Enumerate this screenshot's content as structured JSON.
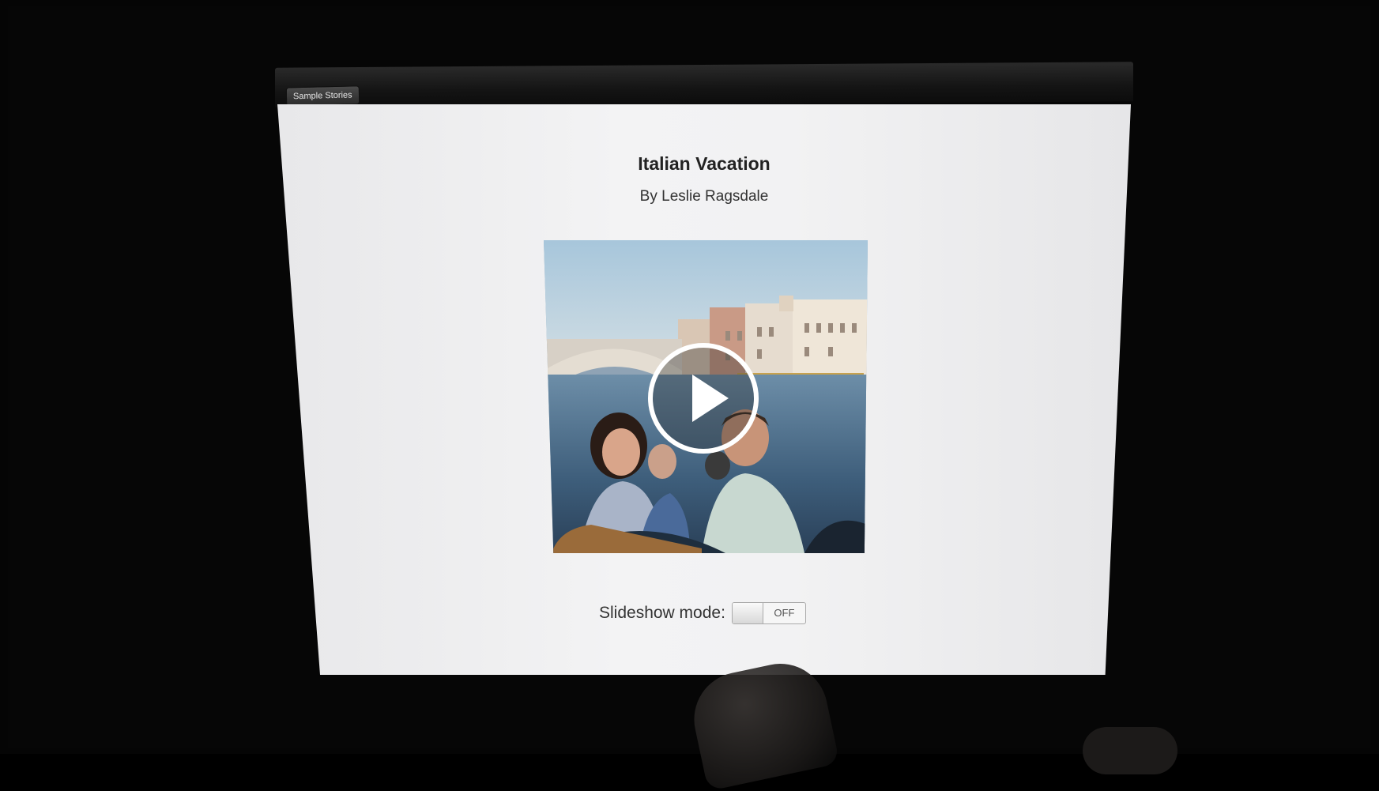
{
  "toolbar": {
    "back_button_label": "Sample Stories"
  },
  "story": {
    "title": "Italian Vacation",
    "author": "By Leslie Ragsdale"
  },
  "slideshow": {
    "label": "Slideshow mode:",
    "toggle_state": "OFF"
  },
  "icons": {
    "play": "play-icon"
  },
  "colors": {
    "background": "#000000",
    "page": "#f2f2f3",
    "toolbar": "#141414"
  }
}
